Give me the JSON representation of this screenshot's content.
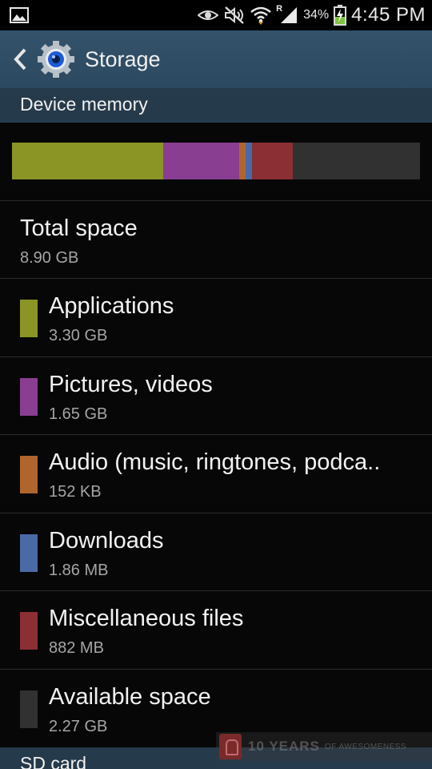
{
  "status_bar": {
    "battery_percent": "34%",
    "time": "4:45 PM",
    "roaming_label": "R",
    "icons": [
      "gallery-icon",
      "eye-icon",
      "mute-icon",
      "wifi-icon",
      "signal-icon",
      "battery-charging-icon"
    ]
  },
  "action_bar": {
    "title": "Storage"
  },
  "device_memory": {
    "header": "Device memory",
    "usage_bar": [
      {
        "name": "Applications",
        "fraction": 0.37,
        "color": "#8a9525"
      },
      {
        "name": "Pictures, videos",
        "fraction": 0.187,
        "color": "#893e91"
      },
      {
        "name": "Audio",
        "fraction": 0.016,
        "color": "#b0652c"
      },
      {
        "name": "Downloads",
        "fraction": 0.016,
        "color": "#4a6aa6"
      },
      {
        "name": "Miscellaneous files",
        "fraction": 0.1,
        "color": "#8b2f35"
      },
      {
        "name": "Available space",
        "fraction": 0.311,
        "color": "#313131"
      }
    ]
  },
  "items": [
    {
      "title": "Total space",
      "value": "8.90 GB"
    },
    {
      "title": "Applications",
      "value": "3.30 GB",
      "color": "#8a9525"
    },
    {
      "title": "Pictures, videos",
      "value": "1.65 GB",
      "color": "#893e91"
    },
    {
      "title": "Audio (music, ringtones, podca..",
      "value": "152 KB",
      "color": "#b0652c"
    },
    {
      "title": "Downloads",
      "value": "1.86 MB",
      "color": "#4a6aa6"
    },
    {
      "title": "Miscellaneous files",
      "value": "882 MB",
      "color": "#8b2f35"
    },
    {
      "title": "Available space",
      "value": "2.27 GB",
      "color": "#313131"
    }
  ],
  "sd_card": {
    "header": "SD card"
  },
  "watermark": {
    "text": "10 YEARS",
    "sub": "OF AWESOMENESS"
  }
}
